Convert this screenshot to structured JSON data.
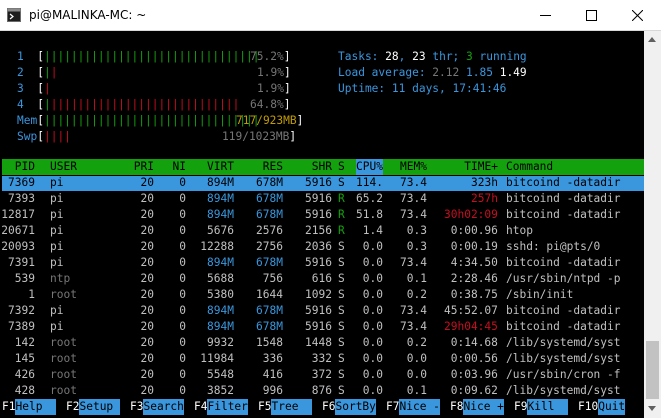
{
  "window": {
    "title": "pi@MALINKA-MC: ~"
  },
  "meters": {
    "cpus": [
      {
        "label": "1",
        "bars": "||||||||||||||||||||||||||||||||",
        "pct": "75.2%"
      },
      {
        "label": "2",
        "bars": "||",
        "pct": "1.9%"
      },
      {
        "label": "3",
        "bars": "|",
        "pct": "1.9%"
      },
      {
        "label": "4",
        "bars": "||||||||||||||||||||||||||||",
        "pct": "64.8%"
      }
    ],
    "mem": {
      "label": "Mem",
      "bars": "||||||||||||||||||||||||||||||||",
      "value": "717/923MB"
    },
    "swp": {
      "label": "Swp",
      "bars": "||||",
      "value": "119/1023MB"
    }
  },
  "summary": {
    "tasks_label": "Tasks: ",
    "tasks": "28",
    "thr_sep": ", ",
    "thr": "23",
    "thr_label": " thr; ",
    "running": "3",
    "running_label": " running",
    "load_label": "Load average: ",
    "load1": "2.12",
    "load5": "1.85",
    "load15": "1.49",
    "uptime_label": "Uptime: ",
    "uptime": "11 days, 17:41:46"
  },
  "table": {
    "headers": [
      "PID",
      "USER",
      "PRI",
      "NI",
      "VIRT",
      "RES",
      "SHR",
      "S",
      "CPU%",
      "MEM%",
      "TIME+",
      "Command"
    ],
    "rows": [
      [
        "7369",
        "pi",
        "20",
        "0",
        "894M",
        "678M",
        "5916",
        "S",
        "114.",
        "73.4",
        "323h",
        "bitcoind -datadir"
      ],
      [
        "7393",
        "pi",
        "20",
        "0",
        "894M",
        "678M",
        "5916",
        "R",
        "65.2",
        "73.4",
        "257h",
        "bitcoind -datadir"
      ],
      [
        "12817",
        "pi",
        "20",
        "0",
        "894M",
        "678M",
        "5916",
        "R",
        "51.8",
        "73.4",
        "30h02:09",
        "bitcoind -datadir"
      ],
      [
        "20671",
        "pi",
        "20",
        "0",
        "5676",
        "2576",
        "2156",
        "R",
        "1.4",
        "0.3",
        "0:00.96",
        "htop"
      ],
      [
        "20093",
        "pi",
        "20",
        "0",
        "12288",
        "2756",
        "2036",
        "S",
        "0.0",
        "0.3",
        "0:00.19",
        "sshd: pi@pts/0"
      ],
      [
        "7391",
        "pi",
        "20",
        "0",
        "894M",
        "678M",
        "5916",
        "S",
        "0.0",
        "73.4",
        "4:34.50",
        "bitcoind -datadir"
      ],
      [
        "539",
        "ntp",
        "20",
        "0",
        "5688",
        "756",
        "616",
        "S",
        "0.0",
        "0.1",
        "2:28.46",
        "/usr/sbin/ntpd -p"
      ],
      [
        "1",
        "root",
        "20",
        "0",
        "5380",
        "1644",
        "1092",
        "S",
        "0.0",
        "0.2",
        "0:38.75",
        "/sbin/init"
      ],
      [
        "7392",
        "pi",
        "20",
        "0",
        "894M",
        "678M",
        "5916",
        "S",
        "0.0",
        "73.4",
        "45:52.07",
        "bitcoind -datadir"
      ],
      [
        "7389",
        "pi",
        "20",
        "0",
        "894M",
        "678M",
        "5916",
        "S",
        "0.0",
        "73.4",
        "29h04:45",
        "bitcoind -datadir"
      ],
      [
        "142",
        "root",
        "20",
        "0",
        "9932",
        "1548",
        "1448",
        "S",
        "0.0",
        "0.2",
        "0:14.68",
        "/lib/systemd/syst"
      ],
      [
        "145",
        "root",
        "20",
        "0",
        "11984",
        "336",
        "332",
        "S",
        "0.0",
        "0.0",
        "0:00.56",
        "/lib/systemd/syst"
      ],
      [
        "426",
        "root",
        "20",
        "0",
        "5548",
        "416",
        "372",
        "S",
        "0.0",
        "0.0",
        "0:03.96",
        "/usr/sbin/cron -f"
      ],
      [
        "428",
        "root",
        "20",
        "0",
        "3852",
        "996",
        "876",
        "S",
        "0.0",
        "0.1",
        "0:09.62",
        "/lib/systemd/syst"
      ]
    ]
  },
  "fkeys": [
    {
      "num": "F1",
      "label": "Help  "
    },
    {
      "num": "F2",
      "label": "Setup "
    },
    {
      "num": "F3",
      "label": "Search"
    },
    {
      "num": "F4",
      "label": "Filter"
    },
    {
      "num": "F5",
      "label": "Tree  "
    },
    {
      "num": "F6",
      "label": "SortBy"
    },
    {
      "num": "F7",
      "label": "Nice -"
    },
    {
      "num": "F8",
      "label": "Nice +"
    },
    {
      "num": "F9",
      "label": "Kill  "
    },
    {
      "num": "F10",
      "label": "Quit"
    }
  ],
  "colors": {
    "green": "#13a10e",
    "cyan": "#3a96dd",
    "red": "#c50f1f",
    "gray": "#767676",
    "blue": "#0037da"
  }
}
